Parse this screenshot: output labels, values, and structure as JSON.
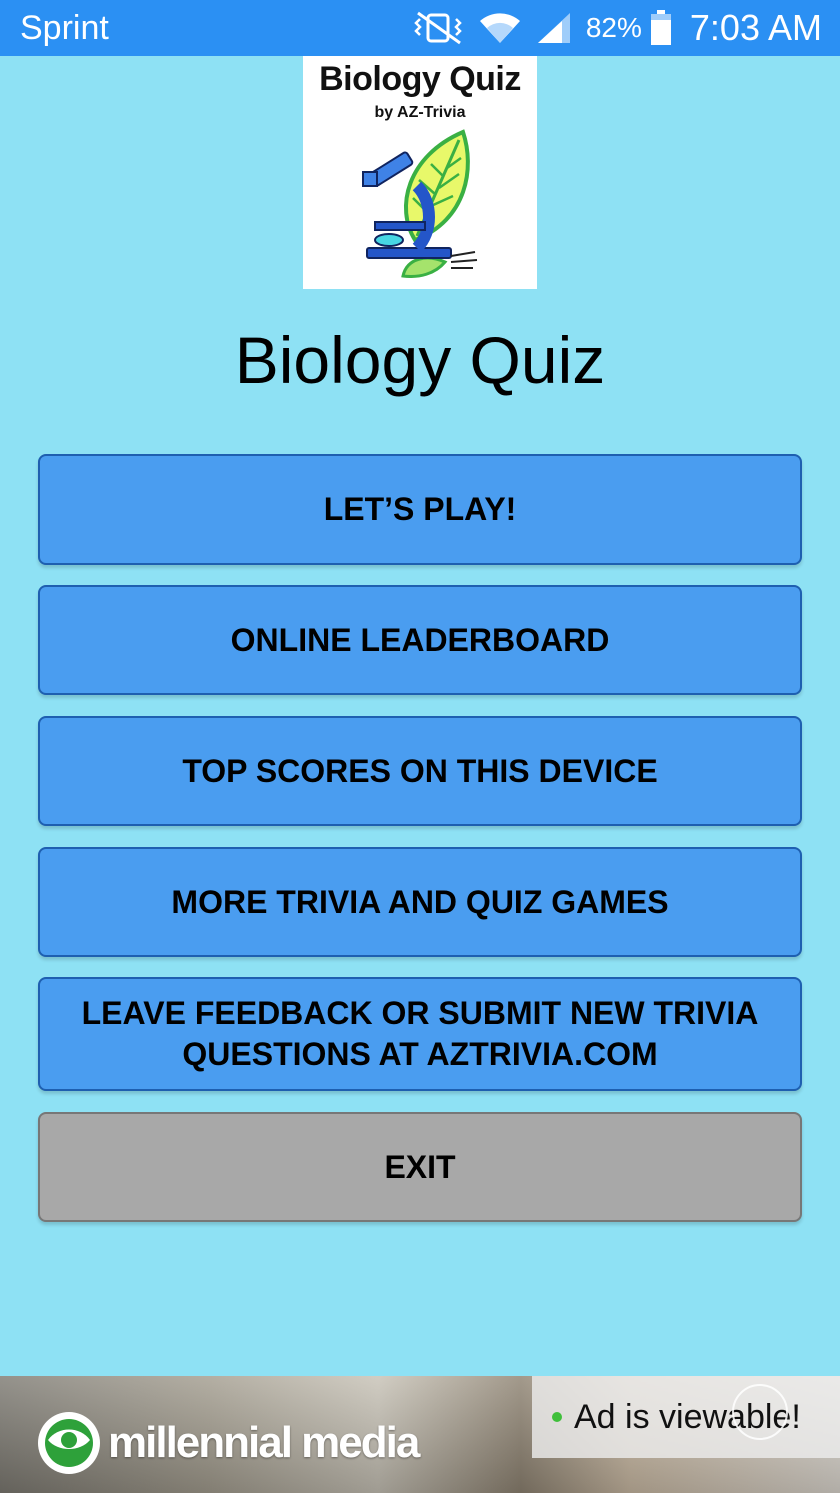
{
  "status_bar": {
    "carrier": "Sprint",
    "battery_percent": "82%",
    "time": "7:03 AM",
    "icons": [
      "vibrate-mute-icon",
      "wifi-icon",
      "signal-icon",
      "battery-icon"
    ]
  },
  "logo": {
    "title": "Biology Quiz",
    "subtitle": "by AZ-Trivia",
    "art": "microscope-leaf-icon"
  },
  "page_title": "Biology Quiz",
  "menu": {
    "play": "LET’S PLAY!",
    "leaderboard": "ONLINE LEADERBOARD",
    "top_scores": "TOP SCORES ON THIS DEVICE",
    "more_games": "MORE TRIVIA AND QUIZ GAMES",
    "feedback": "LEAVE FEEDBACK OR SUBMIT NEW TRIVIA QUESTIONS AT AZTRIVIA.COM",
    "exit": "EXIT"
  },
  "ad": {
    "brand": "millennial media",
    "viewable_label": "Ad is viewable!"
  },
  "colors": {
    "background": "#8ee1f4",
    "status_bar": "#2b90f3",
    "button": "#4a9df0",
    "button_border": "#1e5fb0",
    "exit_button": "#a8a8a8"
  }
}
